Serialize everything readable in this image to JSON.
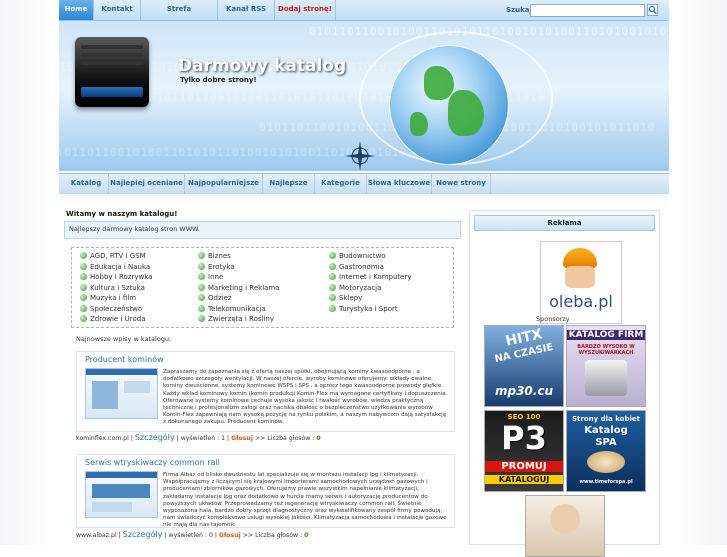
{
  "topnav": {
    "tabs": [
      "Home",
      "Kontakt",
      "Strefa użytkownika",
      "Kanał RSS",
      "Dodaj stronę!"
    ],
    "search_label": "Szukaj",
    "search_value": ""
  },
  "header": {
    "title": "Darmowy katalog",
    "tagline": "Tylko dobre strony!",
    "binary_row": "0101101100101001101010110100101010011010100101011010"
  },
  "subnav": {
    "items": [
      "Katalog",
      "Najlepiej oceniane",
      "Najpopularniejsze",
      "Najlepsze",
      "Kategorie",
      "Słowa kluczowe",
      "Nowe strony"
    ]
  },
  "main": {
    "welcome": "Witamy w naszym katalogu!",
    "intro": "Najlepszy darmowy katalog stron WWW.",
    "categories_col1": [
      "AGD, RTV i GSM",
      "Edukacja i Nauka",
      "Hobby i Rozrywka",
      "Kultura i Sztuka",
      "Muzyka i film",
      "Społeczeństwo",
      "Zdrowie i Uroda"
    ],
    "categories_col2": [
      "Biznes",
      "Erotyka",
      "Inne",
      "Marketing i Reklama",
      "Odzież",
      "Telekomunikacja",
      "Zwierzęta i Rośliny"
    ],
    "categories_col3": [
      "Budownictwo",
      "Gastronomia",
      "Internet i Komputery",
      "Motoryzacja",
      "Sklepy",
      "Turystyka i Sport"
    ],
    "newest_label": "Najnowsze wpisy w katalogu:",
    "entries": [
      {
        "title": "Producent kominów",
        "desc": "Zapraszamy do zapoznania się z ofertą naszej spółki, obejmującą kominy kwasoodporne , a dodatkowo szczegóły wentylacji. W naszej ofercie, wyroby kominowe oferujemy: wkłady owalne, kominy dwuścienne, systemy kominowe WSPS i SPS , a oprócz tego kwasoodporne prowody glęfkie. Każdy wkład kominowy komin (komin produkcji Komin-Flex ma wymagane certyfikaty i dopuszczenia. Oferowane systemy kominowe cechuje wysoka jakość i twałość wyrobów, wiedza praktyczną techniczne i profesjonalizm załogi oraz naciska dbałość o bezpieczeństwo użytkowania wyrobów Komin-Flex zapewniają nam wysoką pozycję na rynku polskim, a naszym nabywcom dają satysfakcję z dokonanego zakupu. Producent kominów.",
        "url": "kominflex.com.pl",
        "details": "Szczegóły",
        "views_label": "wyświetleń :",
        "views": "1",
        "vote": "Głosuj",
        "votes_label": ">> Liczba głosów :",
        "votes": "0"
      },
      {
        "title": "Serwis wtryskiwaczy common rail",
        "desc": "Firma Albaz od blisko dwudziestu lat specjalizuje się w montażu instalacji lpg i klimatyzacji. Współpracujemy z liczącymi się krajowymi importerami samochodowych urządzeń gazowych i producentami zbiorników gazowych. Oferujemy prawie wszystkim napełnianie klimatyzacji, zakładamy instalacje lpg oraz dodatkowo w hurcie mamy serwis i autoryzację producentów do powyższych układów. Przeprowadzamy też regenerację wtryskiwaczy common rail. Świetnie wyposażona hala, bardzo dobry sprzęt diagnostyczny oraz wykwalifikowany zespół firmy powodują, nam świadczyć kompleksowe usługi wysokiej jakości. Klimatyzacja samochodowa i instalacje gazowe nie mają dla nas tajemnic.",
        "url": "www.albaz.pl",
        "details": "Szczegóły",
        "views_label": "wyświetleń :",
        "views": "0",
        "vote": "Głosuj",
        "votes_label": ">> Liczba głosów :",
        "votes": "0"
      }
    ]
  },
  "sidebar": {
    "heading": "Reklama",
    "oleba_text": "oleba.pl",
    "sponsors_label": "Sponsorzy",
    "ads": [
      {
        "line1": "HITX",
        "line2": "NA CZASIE",
        "line3": "mp30.cu"
      },
      {
        "line1": "KATALOG FIRM",
        "line2": "BARDZO WYSOKO W WYSZUKIWARKACH"
      },
      {
        "line1": "SEO 100",
        "line2": "P3",
        "line3": "PROMUJ",
        "line4": "KATALOGUJ"
      },
      {
        "line1": "Strony dla kobiet",
        "line2": "Katalog",
        "line3": "SPA",
        "line4": "www.timeforspa.pl"
      }
    ]
  }
}
